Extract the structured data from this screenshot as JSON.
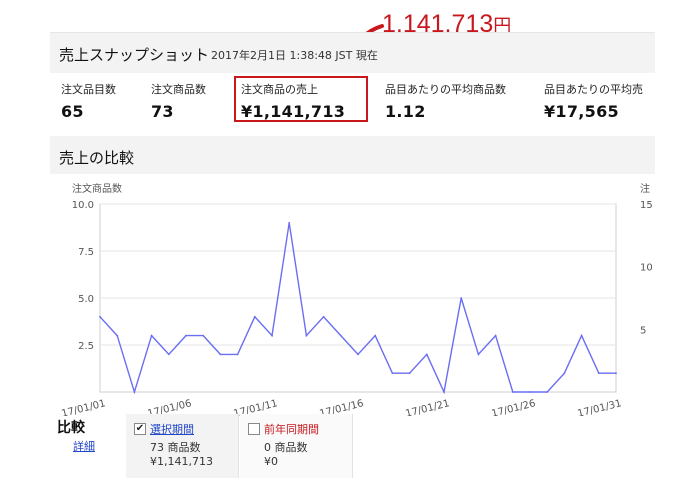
{
  "snapshot": {
    "title": "売上スナップショット",
    "timestamp": "2017年2月1日 1:38:48 JST 現在",
    "metrics": [
      {
        "label": "注文品目数",
        "value": "65"
      },
      {
        "label": "注文商品数",
        "value": "73"
      },
      {
        "label": "注文商品の売上",
        "value": "¥1,141,713"
      },
      {
        "label": "品目あたりの平均商品数",
        "value": "1.12"
      },
      {
        "label": "品目あたりの平均売",
        "value": "¥17,565"
      }
    ]
  },
  "annotation": {
    "amount": "1,141,713",
    "unit": "円",
    "color": "#c8181e"
  },
  "comparison": {
    "title": "売上の比較",
    "label": "比較",
    "details_link": "詳細",
    "selected": {
      "name": "選択期間",
      "checked": true,
      "units": "73 商品数",
      "sales": "¥1,141,713"
    },
    "previous": {
      "name": "前年同期間",
      "checked": false,
      "units": "0 商品数",
      "sales": "¥0"
    }
  },
  "chart_data": {
    "type": "line",
    "ylabel": "注文商品数",
    "ylabel_right": "注",
    "ylim": [
      0,
      10
    ],
    "yticks": [
      "10.0",
      "7.5",
      "5.0",
      "2.5"
    ],
    "yticks_right": [
      "15",
      "10",
      "5"
    ],
    "xticks": [
      "17/01/01",
      "17/01/06",
      "17/01/11",
      "17/01/16",
      "17/01/21",
      "17/01/26",
      "17/01/31"
    ],
    "series": [
      {
        "color": "#6a6ef2",
        "values": [
          4,
          3,
          0,
          3,
          2,
          3,
          3,
          2,
          2,
          4,
          3,
          9,
          3,
          4,
          3,
          2,
          3,
          1,
          1,
          2,
          0,
          5,
          2,
          3,
          0,
          0,
          0,
          1,
          3,
          1,
          1
        ]
      }
    ],
    "grid": true
  }
}
